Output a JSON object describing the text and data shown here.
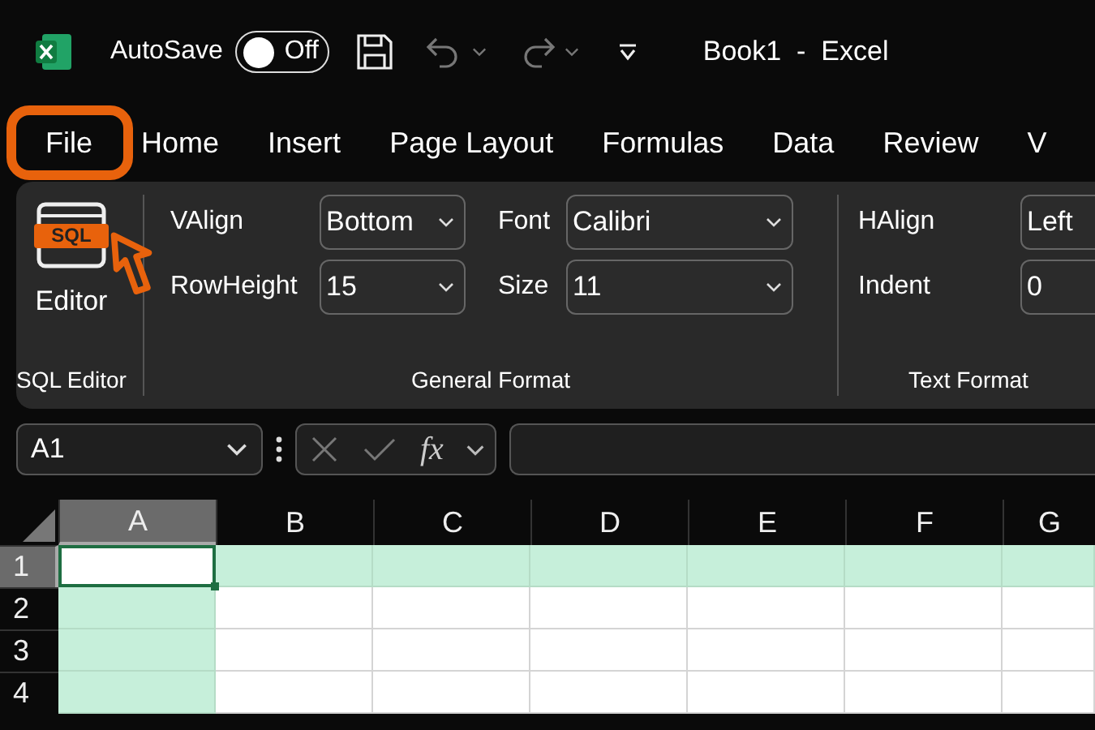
{
  "title_bar": {
    "autosave_label": "AutoSave",
    "autosave": {
      "on": false,
      "label": "Off"
    },
    "title": "Book1  -  Excel"
  },
  "tabs": [
    {
      "label": "File",
      "selected": false,
      "highlighted": true
    },
    {
      "label": "Home",
      "selected": false,
      "highlighted": false
    },
    {
      "label": "Insert",
      "selected": false,
      "highlighted": false
    },
    {
      "label": "Page Layout",
      "selected": false,
      "highlighted": false
    },
    {
      "label": "Formulas",
      "selected": false,
      "highlighted": false
    },
    {
      "label": "Data",
      "selected": false,
      "highlighted": false
    },
    {
      "label": "Review",
      "selected": false,
      "highlighted": false
    },
    {
      "label": "V",
      "selected": false,
      "highlighted": false
    }
  ],
  "ribbon": {
    "groups": [
      {
        "kind": "button",
        "label": "SQL Editor",
        "button": {
          "icon_text": "SQL",
          "label": "Editor"
        }
      },
      {
        "kind": "fields",
        "label": "General Format",
        "fields": [
          {
            "label": "VAlign",
            "value": "Bottom"
          },
          {
            "label": "Font",
            "value": "Calibri"
          },
          {
            "label": "RowHeight",
            "value": "15"
          },
          {
            "label": "Size",
            "value": "11"
          }
        ]
      },
      {
        "kind": "fields",
        "label": "Text Format",
        "fields": [
          {
            "label": "HAlign",
            "value": "Left"
          },
          {
            "label": "Indent",
            "value": "0"
          }
        ]
      }
    ]
  },
  "formula_bar": {
    "name_box": "A1",
    "function_label": "fx"
  },
  "grid": {
    "columns": [
      {
        "label": "A",
        "selected": true
      },
      {
        "label": "B",
        "selected": false
      },
      {
        "label": "C",
        "selected": false
      },
      {
        "label": "D",
        "selected": false
      },
      {
        "label": "E",
        "selected": false
      },
      {
        "label": "F",
        "selected": false
      },
      {
        "label": "G",
        "selected": false
      }
    ],
    "rows": [
      {
        "label": "1",
        "selected": true
      },
      {
        "label": "2",
        "selected": false
      },
      {
        "label": "3",
        "selected": false
      },
      {
        "label": "4",
        "selected": false
      }
    ]
  }
}
